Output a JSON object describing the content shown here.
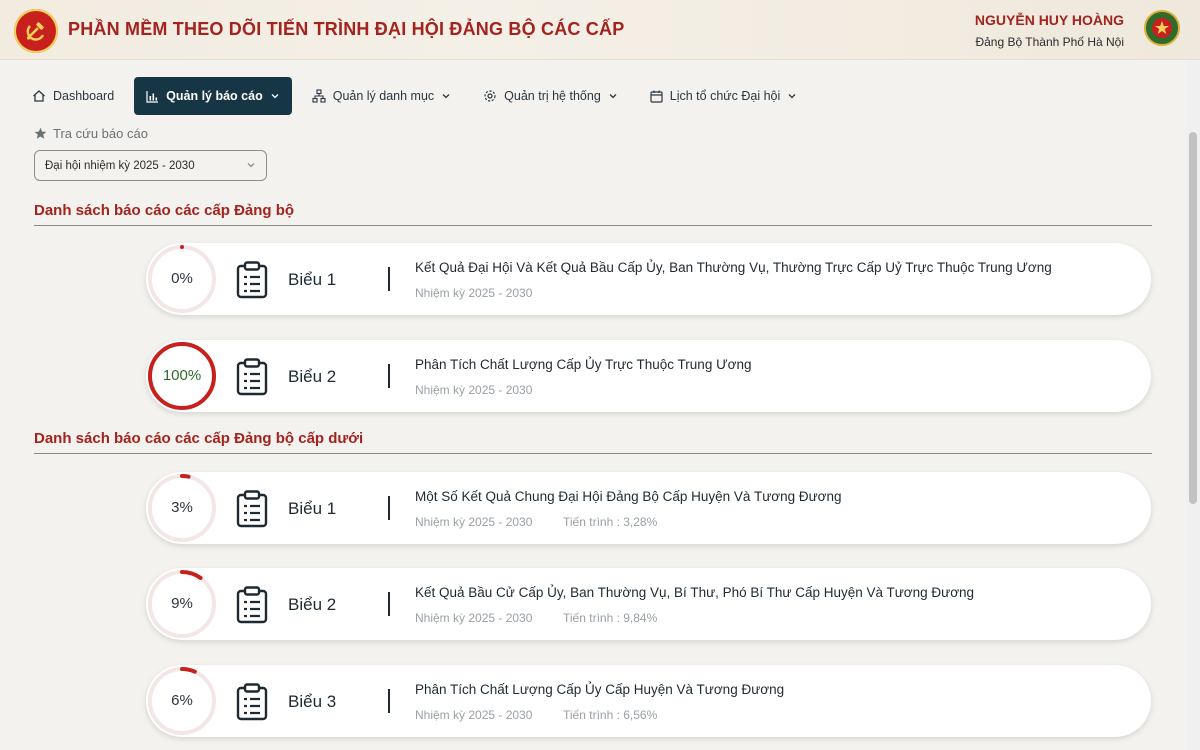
{
  "header": {
    "app_title": "PHẦN MỀM THEO DÕI TIẾN TRÌNH ĐẠI HỘI ĐẢNG BỘ CÁC CẤP",
    "user_name": "NGUYỄN HUY HOÀNG",
    "user_org": "Đảng Bộ Thành Phố Hà Nội",
    "logo_icon": "party-logo-icon",
    "emblem_icon": "emblem-icon"
  },
  "nav": {
    "items": [
      {
        "label": "Dashboard",
        "icon": "home-icon",
        "active": false
      },
      {
        "label": "Quản lý báo cáo",
        "icon": "chart-icon",
        "active": true
      },
      {
        "label": "Quản lý danh mục",
        "icon": "hierarchy-icon",
        "active": false
      },
      {
        "label": "Quản trị hệ thống",
        "icon": "gear-icon",
        "active": false
      },
      {
        "label": "Lịch tổ chức Đại hội",
        "icon": "calendar-icon",
        "active": false
      }
    ]
  },
  "search": {
    "label": "Tra cứu báo cáo",
    "selected": "Đại hội nhiệm kỳ 2025 - 2030"
  },
  "sections": [
    {
      "title": "Danh sách báo cáo các cấp Đảng bộ",
      "reports": [
        {
          "percent_label": "0%",
          "percent": 0,
          "form": "Biểu 1",
          "title": "Kết Quả Đại Hội Và Kết Quả Bầu Cấp Ủy, Ban Thường Vụ, Thường Trực Cấp Uỷ Trực Thuộc Trung Ương",
          "term": "Nhiệm kỳ 2025 - 2030",
          "progress": ""
        },
        {
          "percent_label": "100%",
          "percent": 100,
          "form": "Biểu 2",
          "title": "Phân Tích Chất Lượng Cấp Ủy Trực Thuộc Trung Ương",
          "term": "Nhiệm kỳ 2025 - 2030",
          "progress": ""
        }
      ]
    },
    {
      "title": "Danh sách báo cáo các cấp Đảng bộ cấp dưới",
      "reports": [
        {
          "percent_label": "3%",
          "percent": 3.28,
          "form": "Biểu 1",
          "title": "Một Số Kết Quả Chung Đại Hội Đảng Bộ Cấp Huyện Và Tương Đương",
          "term": "Nhiệm kỳ 2025 - 2030",
          "progress": "Tiến trình : 3,28%"
        },
        {
          "percent_label": "9%",
          "percent": 9.84,
          "form": "Biểu 2",
          "title": "Kết Quả Bầu Cử Cấp Ủy, Ban Thường Vụ, Bí Thư, Phó Bí Thư Cấp Huyện Và Tương Đương",
          "term": "Nhiệm kỳ 2025 - 2030",
          "progress": "Tiến trình : 9,84%"
        },
        {
          "percent_label": "6%",
          "percent": 6.56,
          "form": "Biểu 3",
          "title": "Phân Tích Chất Lượng Cấp Ủy Cấp Huyện Và Tương Đương",
          "term": "Nhiệm kỳ 2025 - 2030",
          "progress": "Tiến trình : 6,56%"
        }
      ]
    }
  ],
  "colors": {
    "accent": "#a3231f",
    "nav_active": "#173645",
    "ring": "#c8201d",
    "full_text": "#2e6b2b"
  }
}
